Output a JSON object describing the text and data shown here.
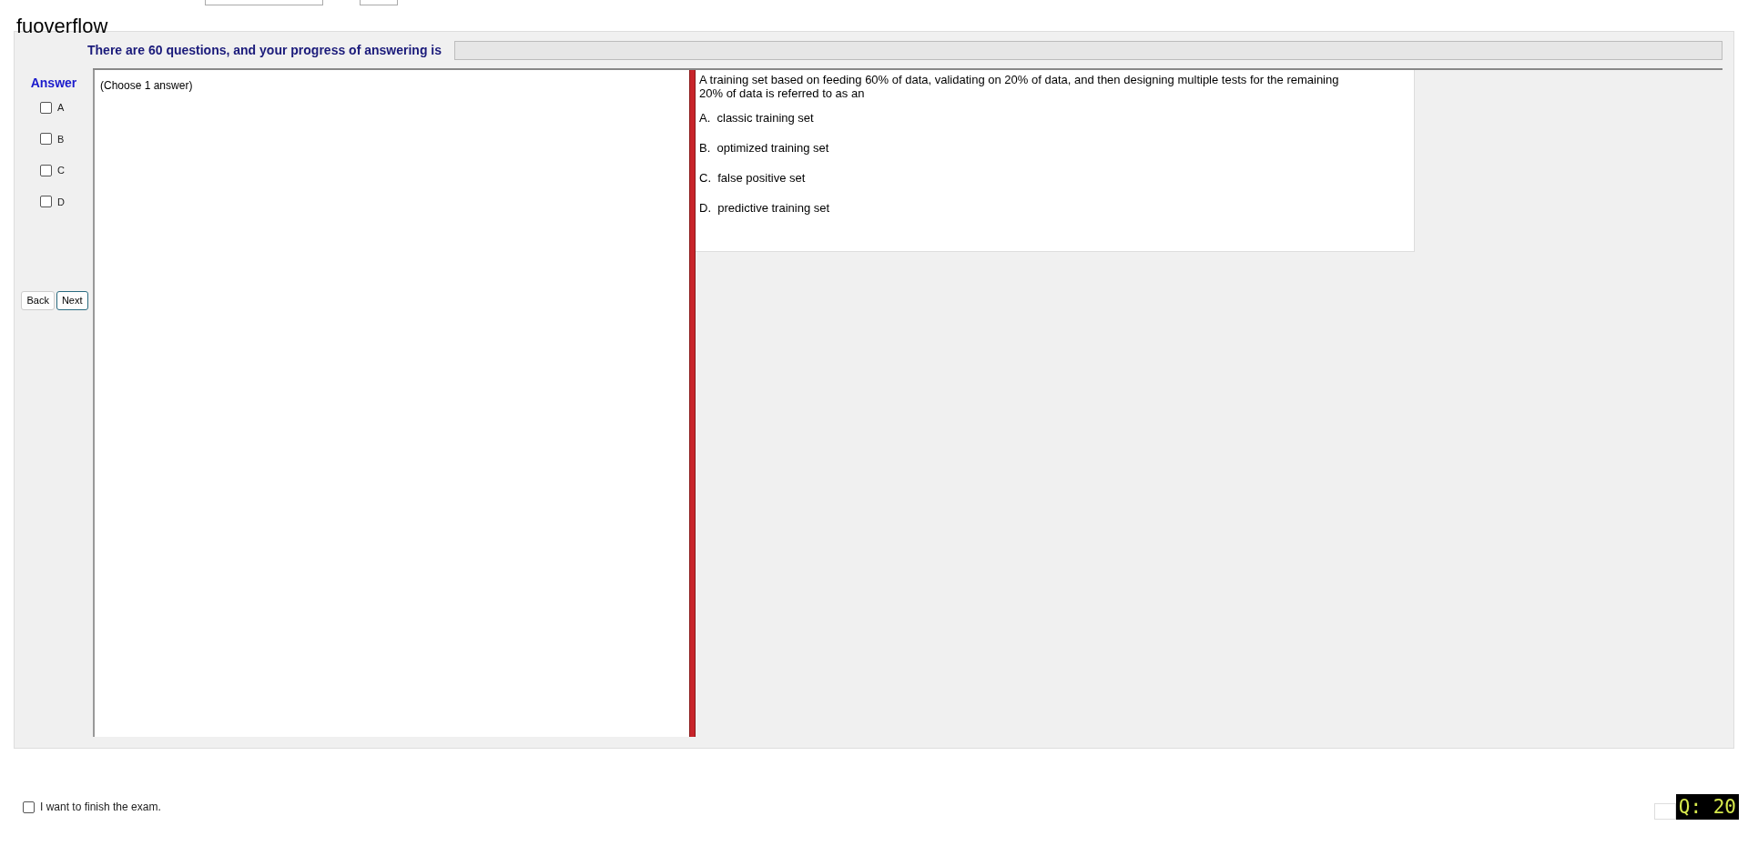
{
  "title": "fuoverflow",
  "progress": {
    "label": "There are 60 questions, and your progress of answering is",
    "level": 0
  },
  "answer": {
    "heading": "Answer",
    "options": [
      {
        "label": "A",
        "checked": false
      },
      {
        "label": "B",
        "checked": false
      },
      {
        "label": "C",
        "checked": false
      },
      {
        "label": "D",
        "checked": false
      }
    ]
  },
  "nav_buttons": [
    {
      "label": "Back",
      "selected": false
    },
    {
      "label": "Next",
      "selected": true
    }
  ],
  "instruction": "(Choose 1 answer)",
  "question": {
    "text": "A training set based on feeding 60% of data, validating on 20% of data, and then designing multiple tests for the remaining 20% of data is referred to as an",
    "choices": [
      "A.  classic training set",
      "B.  optimized training set",
      "C.  false positive set",
      "D.  predictive training set"
    ]
  },
  "finish": {
    "label": "I want to finish the exam.",
    "checked": false
  },
  "question_counter": "Q: 20"
}
